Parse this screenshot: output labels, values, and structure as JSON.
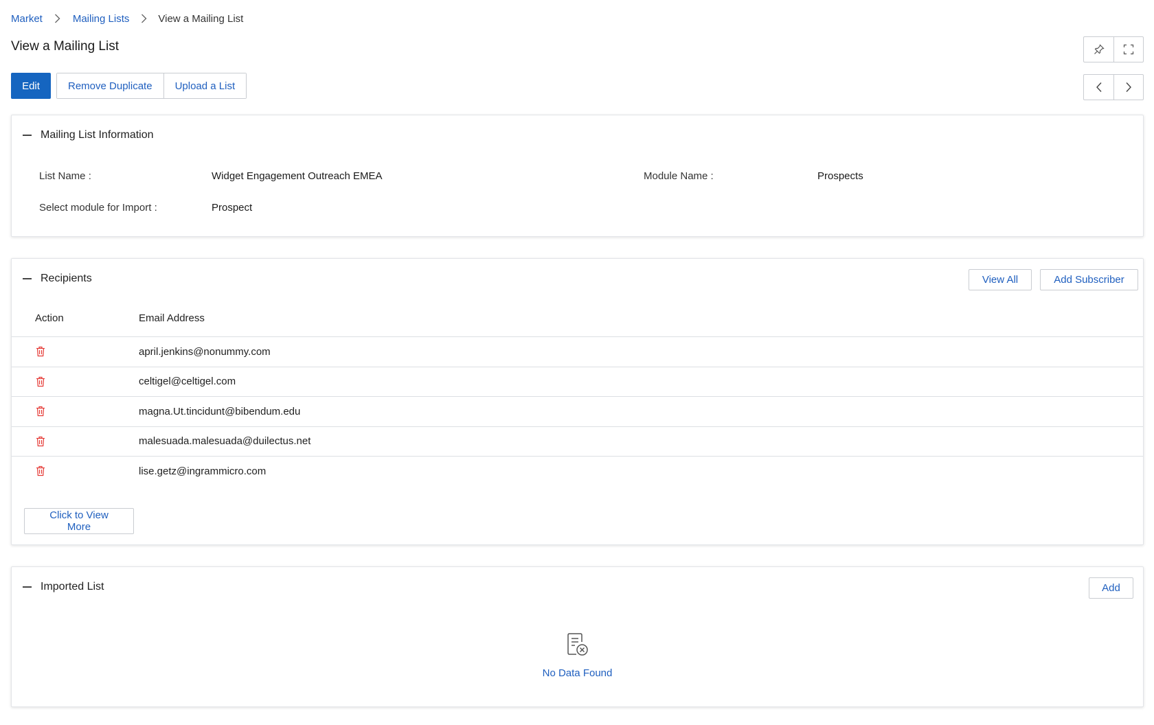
{
  "breadcrumb": {
    "items": [
      "Market",
      "Mailing Lists",
      "View a Mailing List"
    ]
  },
  "page_title": "View a Mailing List",
  "toolbar": {
    "edit_label": "Edit",
    "remove_duplicate_label": "Remove Duplicate",
    "upload_list_label": "Upload a List"
  },
  "info": {
    "section_title": "Mailing List Information",
    "list_name_label": "List Name :",
    "list_name_value": "Widget Engagement Outreach EMEA",
    "module_name_label": "Module Name :",
    "module_name_value": "Prospects",
    "import_module_label": "Select module for Import :",
    "import_module_value": "Prospect"
  },
  "recipients": {
    "section_title": "Recipients",
    "view_all_label": "View All",
    "add_subscriber_label": "Add Subscriber",
    "columns": [
      "Action",
      "Email Address"
    ],
    "rows": [
      "april.jenkins@nonummy.com",
      "celtigel@celtigel.com",
      "magna.Ut.tincidunt@bibendum.edu",
      "malesuada.malesuada@duilectus.net",
      "lise.getz@ingrammicro.com"
    ],
    "view_more_label": "Click to View More"
  },
  "imported": {
    "section_title": "Imported List",
    "add_label": "Add",
    "empty_text": "No Data Found"
  },
  "colors": {
    "primary": "#1565c0",
    "link": "#1f5fbf",
    "delete": "#e53935"
  },
  "icons": [
    "chevron-right-icon",
    "pin-icon",
    "fullscreen-icon",
    "chevron-left-icon",
    "trash-icon",
    "no-data-icon"
  ]
}
